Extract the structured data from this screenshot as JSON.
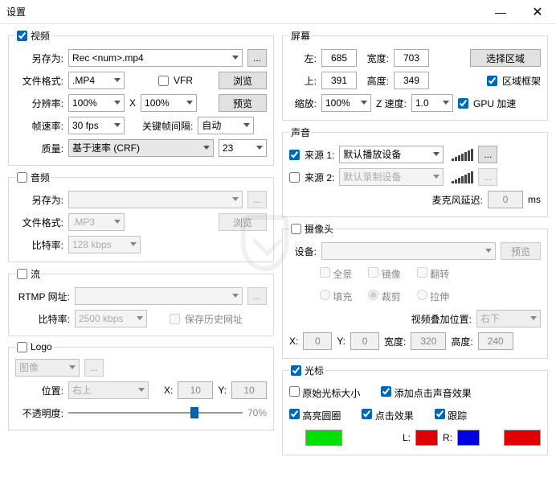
{
  "window": {
    "title": "设置"
  },
  "video": {
    "legend": "视频",
    "saveAsLabel": "另存为:",
    "saveAs": "Rec <num>.mp4",
    "browseBtn": "...",
    "fmtLabel": "文件格式:",
    "fmt": ".MP4",
    "vfrLabel": "VFR",
    "browse": "浏览",
    "resLabel": "分辨率:",
    "res1": "100%",
    "resX": "X",
    "res2": "100%",
    "preview": "预览",
    "fpsLabel": "帧速率:",
    "fps": "30 fps",
    "keyLabel": "关键帧间隔:",
    "key": "自动",
    "qLabel": "质量:",
    "qMode": "基于速率 (CRF)",
    "qVal": "23"
  },
  "audio": {
    "legend": "音频",
    "saveAsLabel": "另存为:",
    "saveAs": "",
    "browseBtn": "...",
    "fmtLabel": "文件格式:",
    "fmt": ".MP3",
    "browse": "浏览",
    "brLabel": "比特率:",
    "br": "128 kbps"
  },
  "stream": {
    "legend": "流",
    "urlLabel": "RTMP 网址:",
    "url": "",
    "browseBtn": "...",
    "brLabel": "比特率:",
    "br": "2500 kbps",
    "saveHistLabel": "保存历史网址"
  },
  "logo": {
    "legend": "Logo",
    "img": "图像",
    "browseBtn": "...",
    "posLabel": "位置:",
    "pos": "右上",
    "xLabel": "X:",
    "x": "10",
    "yLabel": "Y:",
    "y": "10",
    "opLabel": "不透明度:",
    "opVal": "70%"
  },
  "screen": {
    "legend": "屏幕",
    "leftLabel": "左:",
    "left": "685",
    "widthLabel": "宽度:",
    "width": "703",
    "selectBtn": "选择区域",
    "topLabel": "上:",
    "top": "391",
    "heightLabel": "高度:",
    "height": "349",
    "frameLabel": "区域框架",
    "zoomLabel": "缩放:",
    "zoom": "100%",
    "zspeedLabel": "Z 速度:",
    "zspeed": "1.0",
    "gpuLabel": "GPU 加速"
  },
  "sound": {
    "legend": "声音",
    "src1Label": "来源 1:",
    "src1": "默认播放设备",
    "btn": "...",
    "src2Label": "来源 2:",
    "src2": "默认录制设备",
    "micDelayLabel": "麦克风延迟:",
    "micDelay": "0",
    "ms": "ms"
  },
  "camera": {
    "legend": "摄像头",
    "devLabel": "设备:",
    "dev": "",
    "preview": "预览",
    "panLabel": "全景",
    "mirLabel": "镜像",
    "flipLabel": "翻转",
    "fillLabel": "填充",
    "cropLabel": "裁剪",
    "stretchLabel": "拉伸",
    "overlayLabel": "视频叠加位置:",
    "overlayPos": "右下",
    "xLabel": "X:",
    "x": "0",
    "yLabel": "Y:",
    "y": "0",
    "wLabel": "宽度:",
    "w": "320",
    "hLabel": "高度:",
    "h": "240"
  },
  "cursor": {
    "legend": "光标",
    "origLabel": "原始光标大小",
    "clickSoundLabel": "添加点击声音效果",
    "hlLabel": "高亮圆圈",
    "clickFxLabel": "点击效果",
    "trackLabel": "跟踪",
    "lLabel": "L:",
    "rLabel": "R:"
  }
}
